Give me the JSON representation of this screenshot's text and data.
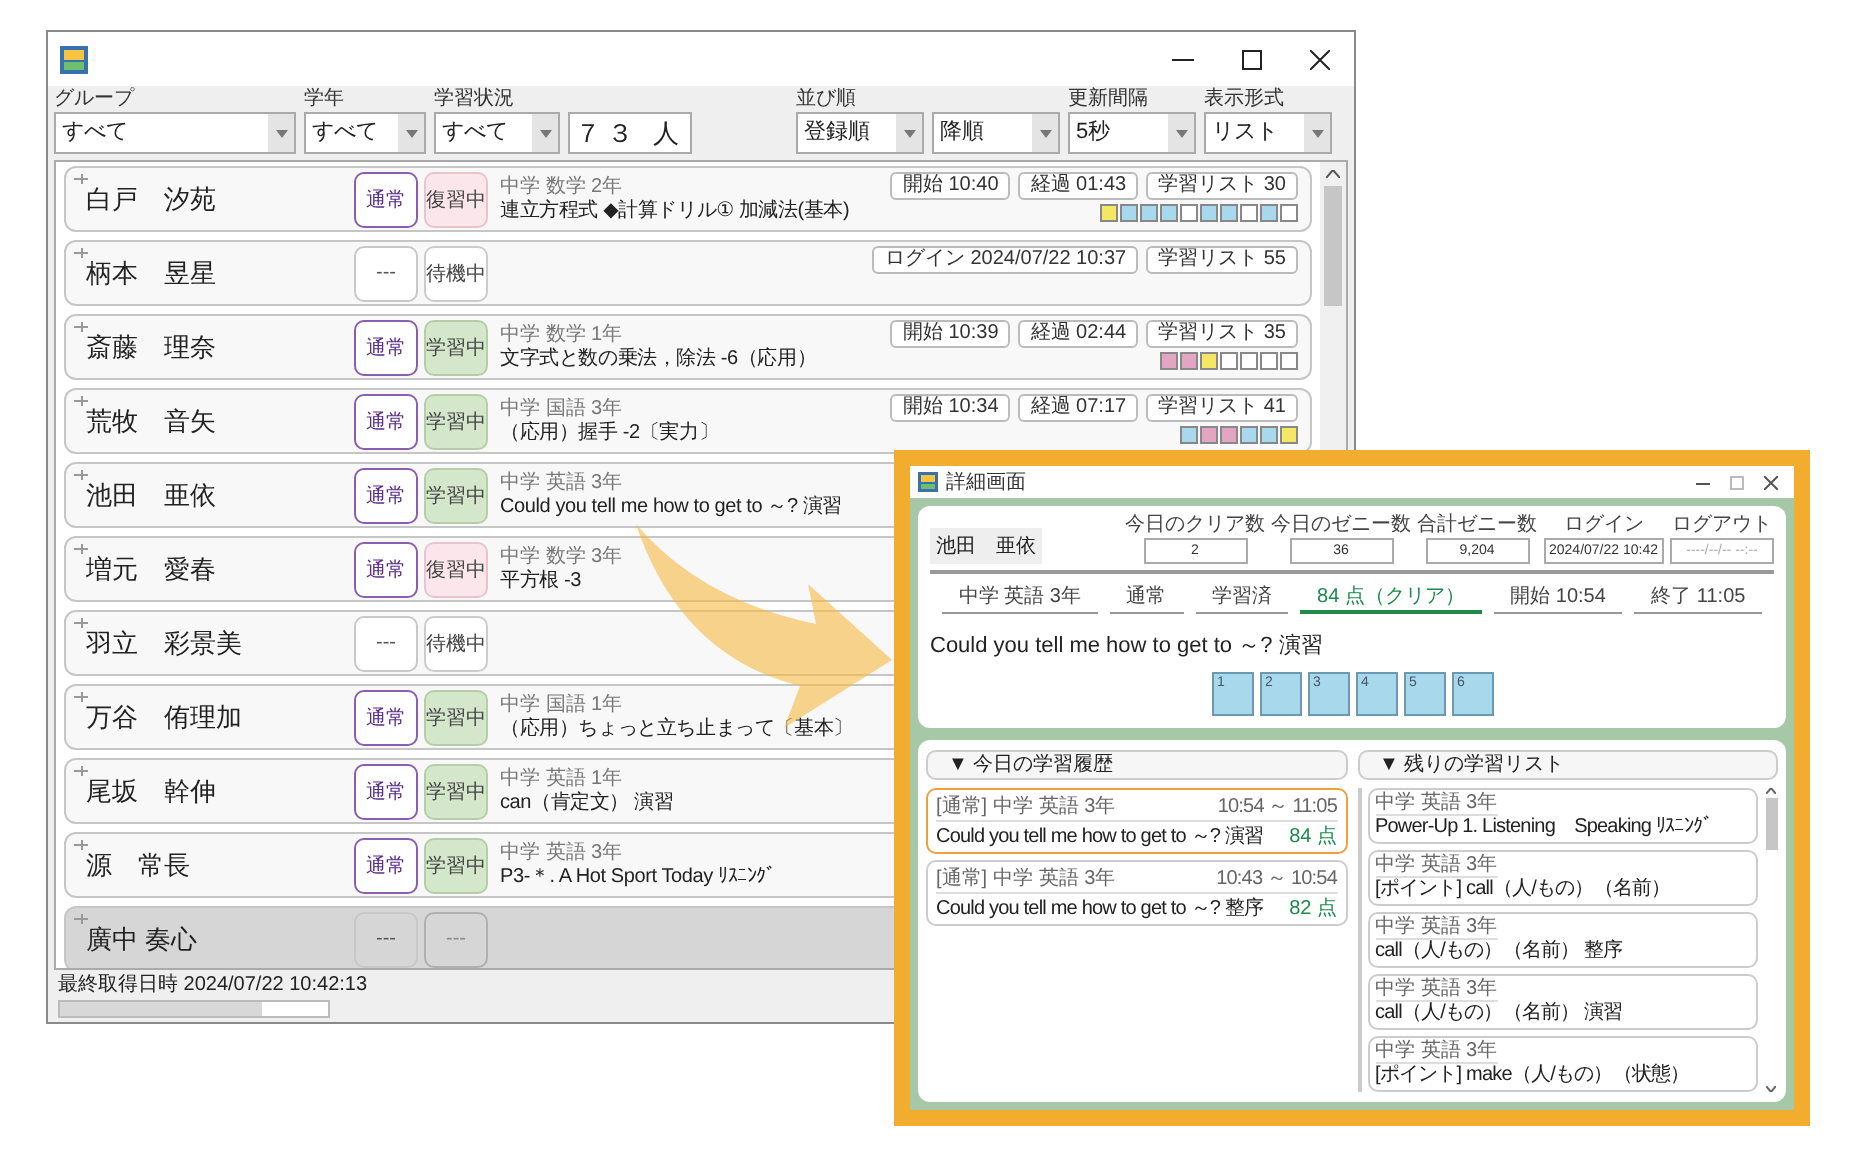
{
  "main_window": {
    "filters": [
      {
        "label": "グループ",
        "value": "すべて",
        "kind": "select"
      },
      {
        "label": "学年",
        "value": "すべて",
        "kind": "select"
      },
      {
        "label": "学習状況",
        "value": "すべて",
        "kind": "select"
      },
      {
        "value": "７３ 人",
        "kind": "count"
      },
      {
        "label": "並び順",
        "value": "登録順",
        "kind": "select"
      },
      {
        "value": "降順",
        "kind": "select"
      },
      {
        "label": "更新間隔",
        "value": "5秒",
        "kind": "select"
      },
      {
        "label": "表示形式",
        "value": "リスト",
        "kind": "select"
      }
    ],
    "students": [
      {
        "name": "白戸　汐苑",
        "mode": {
          "label": "通常",
          "kind": "normal"
        },
        "status": {
          "label": "復習中",
          "kind": "review"
        },
        "disabled": false,
        "subject": "中学 数学 2年",
        "title": "連立方程式 ◆計算ドリル① 加減法(基本)",
        "chips": [
          "開始 10:40",
          "経過 01:43",
          "学習リスト 30"
        ],
        "squares": [
          {
            "color": "#f5e663"
          },
          {
            "color": "#a8d8ee"
          },
          {
            "color": "#a8d8ee"
          },
          {
            "color": "#a8d8ee"
          },
          {
            "color": "#ffffff"
          },
          {
            "color": "#a8d8ee"
          },
          {
            "color": "#a8d8ee"
          },
          {
            "color": "#ffffff"
          },
          {
            "color": "#a8d8ee"
          },
          {
            "color": "#ffffff"
          }
        ]
      },
      {
        "name": "柄本　昱星",
        "mode": {
          "label": "---",
          "kind": "none"
        },
        "status": {
          "label": "待機中",
          "kind": "idle"
        },
        "disabled": false,
        "chips": [
          "ログイン 2024/07/22 10:37",
          "学習リスト 55"
        ]
      },
      {
        "name": "斎藤　理奈",
        "mode": {
          "label": "通常",
          "kind": "normal"
        },
        "status": {
          "label": "学習中",
          "kind": "study"
        },
        "disabled": false,
        "subject": "中学 数学 1年",
        "title": "文字式と数の乗法，除法 -6（応用）",
        "chips": [
          "開始 10:39",
          "経過 02:44",
          "学習リスト 35"
        ],
        "squares": [
          {
            "color": "#e2a6c2"
          },
          {
            "color": "#e2a6c2"
          },
          {
            "color": "#f5e663"
          },
          {
            "color": "#ffffff"
          },
          {
            "color": "#ffffff"
          },
          {
            "color": "#ffffff"
          },
          {
            "color": "#ffffff"
          }
        ]
      },
      {
        "name": "荒牧　音矢",
        "mode": {
          "label": "通常",
          "kind": "normal"
        },
        "status": {
          "label": "学習中",
          "kind": "study"
        },
        "disabled": false,
        "subject": "中学 国語 3年",
        "title": "（応用）握手 -2〔実力〕",
        "chips": [
          "開始 10:34",
          "経過 07:17",
          "学習リスト 41"
        ],
        "squares": [
          {
            "color": "#a8d8ee"
          },
          {
            "color": "#e2a6c2"
          },
          {
            "color": "#e2a6c2"
          },
          {
            "color": "#a8d8ee"
          },
          {
            "color": "#a8d8ee"
          },
          {
            "color": "#f5e663"
          }
        ]
      },
      {
        "name": "池田　亜依",
        "mode": {
          "label": "通常",
          "kind": "normal"
        },
        "status": {
          "label": "学習中",
          "kind": "study"
        },
        "disabled": false,
        "subject": "中学 英語 3年",
        "title": "Could you tell me how to get to ～? 演習"
      },
      {
        "name": "増元　愛春",
        "mode": {
          "label": "通常",
          "kind": "normal"
        },
        "status": {
          "label": "復習中",
          "kind": "review"
        },
        "disabled": false,
        "subject": "中学 数学 3年",
        "title": "平方根 -3"
      },
      {
        "name": "羽立　彩景美",
        "mode": {
          "label": "---",
          "kind": "none"
        },
        "status": {
          "label": "待機中",
          "kind": "idle"
        },
        "disabled": false
      },
      {
        "name": "万谷　侑理加",
        "mode": {
          "label": "通常",
          "kind": "normal"
        },
        "status": {
          "label": "学習中",
          "kind": "study"
        },
        "disabled": false,
        "subject": "中学 国語 1年",
        "title": "（応用）ちょっと立ち止まって〔基本〕"
      },
      {
        "name": "尾坂　幹伸",
        "mode": {
          "label": "通常",
          "kind": "normal"
        },
        "status": {
          "label": "学習中",
          "kind": "study"
        },
        "disabled": false,
        "subject": "中学 英語 1年",
        "title": "can（肯定文） 演習"
      },
      {
        "name": "源　常長",
        "mode": {
          "label": "通常",
          "kind": "normal"
        },
        "status": {
          "label": "学習中",
          "kind": "study"
        },
        "disabled": false,
        "subject": "中学 英語 3年",
        "title": "P3-＊. A Hot Sport Today ﾘｽﾆﾝｸﾞ"
      },
      {
        "name": "廣中 奏心",
        "mode": {
          "label": "---",
          "kind": "none"
        },
        "status": {
          "label": "---",
          "kind": "none"
        },
        "disabled": true
      }
    ],
    "status_bar": {
      "text": "最終取得日時 2024/07/22 10:42:13",
      "level": 0.75
    }
  },
  "detail_window": {
    "title": "詳細画面",
    "student": "池田　亜依",
    "stats": [
      {
        "label": "今日のクリア数",
        "value": "2",
        "muted": false
      },
      {
        "label": "今日のゼニー数",
        "value": "36",
        "muted": false
      },
      {
        "label": "合計ゼニー数",
        "value": "9,204",
        "muted": false
      },
      {
        "label": "ログイン",
        "value": "2024/07/22 10:42",
        "muted": false
      },
      {
        "label": "ログアウト",
        "value": "----/--/-- --:--",
        "muted": true
      }
    ],
    "info": [
      {
        "text": "中学 英語 3年",
        "highlight": false
      },
      {
        "text": "通常",
        "highlight": false
      },
      {
        "text": "学習済",
        "highlight": false
      },
      {
        "text": "84 点（クリア）",
        "highlight": true
      },
      {
        "text": "開始 10:54",
        "highlight": false
      },
      {
        "text": "終了 11:05",
        "highlight": false
      }
    ],
    "lesson_title": "Could you tell me how to get to ～? 演習",
    "steps": [
      "1",
      "2",
      "3",
      "4",
      "5",
      "6"
    ],
    "history": {
      "header": "▼ 今日の学習履歴",
      "items": [
        {
          "tag": "[通常]",
          "subject": "中学 英語 3年",
          "time": "10:54 ～ 11:05",
          "title": "Could you tell me how to get to ～? 演習",
          "score": "84 点",
          "selected": true
        },
        {
          "tag": "[通常]",
          "subject": "中学 英語 3年",
          "time": "10:43 ～ 10:54",
          "title": "Could you tell me how to get to ～? 整序",
          "score": "82 点",
          "selected": false
        }
      ]
    },
    "remaining": {
      "header": "▼ 残りの学習リスト",
      "items": [
        {
          "subject": "中学 英語 3年",
          "title": "Power-Up 1. Listening　Speaking ﾘｽﾆﾝｸﾞ"
        },
        {
          "subject": "中学 英語 3年",
          "title": "[ポイント] call（人/もの）（名前）"
        },
        {
          "subject": "中学 英語 3年",
          "title": "call（人/もの）（名前） 整序"
        },
        {
          "subject": "中学 英語 3年",
          "title": "call（人/もの）（名前） 演習"
        },
        {
          "subject": "中学 英語 3年",
          "title": "[ポイント] make（人/もの）（状態）"
        }
      ]
    }
  }
}
